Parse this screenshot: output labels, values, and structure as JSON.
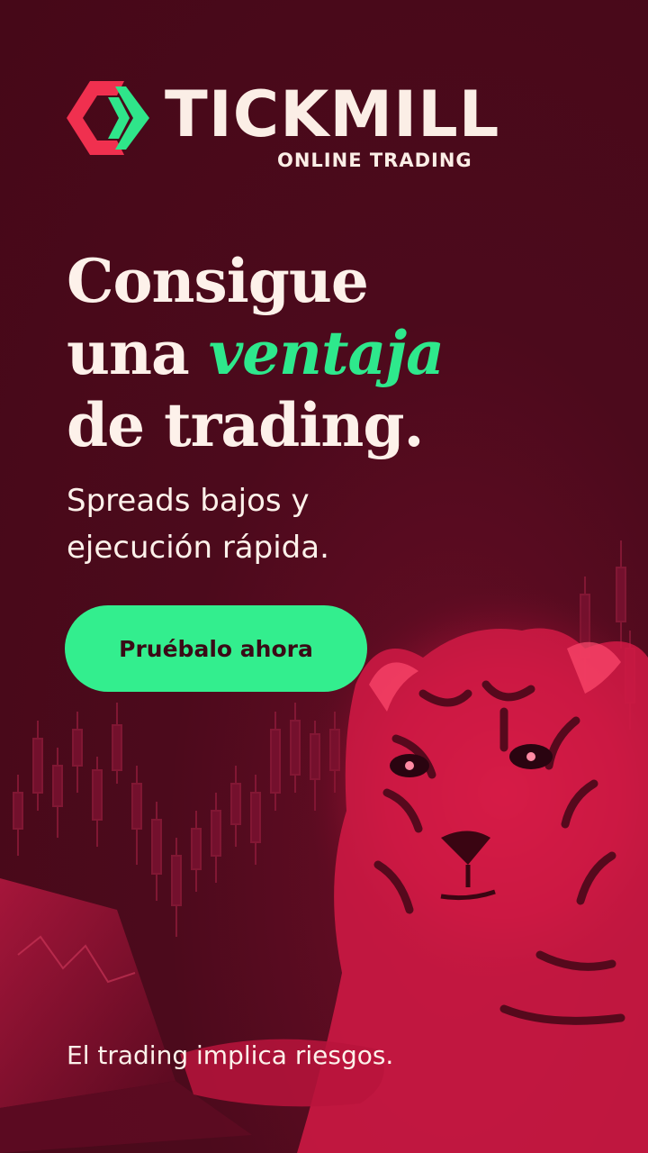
{
  "brand": {
    "name": "TICKMILL",
    "tagline": "ONLINE TRADING",
    "colors": {
      "mark_red": "#f0304f",
      "mark_green": "#2fe58a"
    }
  },
  "headline": {
    "line1": "Consigue",
    "line2_prefix": "una ",
    "line2_accent": "ventaja",
    "line3": "de trading."
  },
  "subheadline": {
    "line1": "Spreads bajos y",
    "line2": "ejecución rápida."
  },
  "cta": {
    "label": "Pruébalo ahora"
  },
  "disclaimer": "El trading implica riesgos.",
  "colors": {
    "background": "#4a0819",
    "accent_green": "#2ee88c",
    "button_green": "#33ee8e",
    "text_light": "#fdf1ea",
    "tiger_pink": "#e0204a"
  },
  "background_image": "tiger-icon"
}
